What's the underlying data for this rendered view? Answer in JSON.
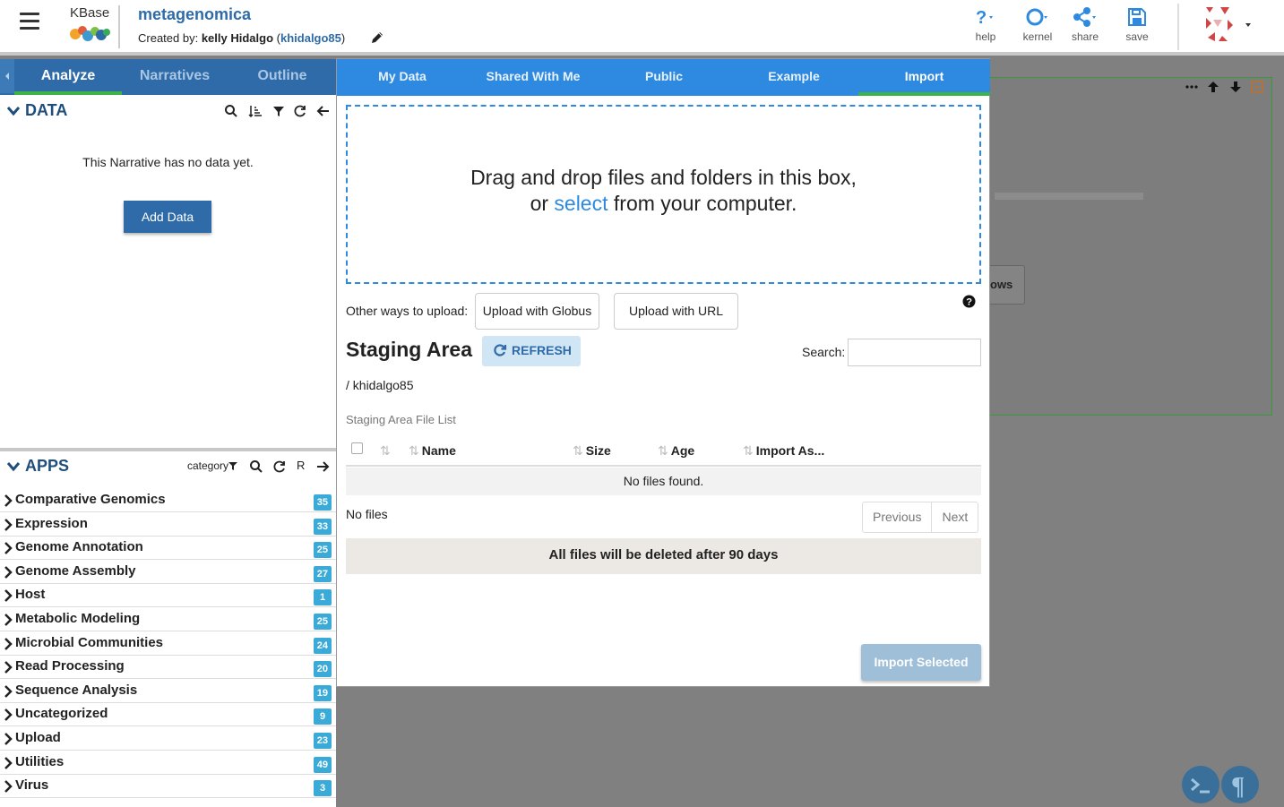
{
  "header": {
    "logo_text": "KBase",
    "narrative_title": "metagenomica",
    "created_by_prefix": "Created by: ",
    "owner_name": "kelly Hidalgo",
    "owner_open": " (",
    "owner_username": "khidalgo85",
    "owner_close": ")",
    "buttons": {
      "help": "help",
      "kernel": "kernel",
      "share": "share",
      "save": "save"
    }
  },
  "left_panel": {
    "tabs": [
      "Analyze",
      "Narratives",
      "Outline"
    ],
    "active_tab": "Analyze",
    "data_section": {
      "title": "DATA",
      "empty_message": "This Narrative has no data yet.",
      "add_button": "Add Data"
    },
    "apps_section": {
      "title": "APPS",
      "sort_label": "category",
      "r_label": "R",
      "categories": [
        {
          "name": "Comparative Genomics",
          "count": "35"
        },
        {
          "name": "Expression",
          "count": "33"
        },
        {
          "name": "Genome Annotation",
          "count": "25"
        },
        {
          "name": "Genome Assembly",
          "count": "27"
        },
        {
          "name": "Host",
          "count": "1"
        },
        {
          "name": "Metabolic Modeling",
          "count": "25"
        },
        {
          "name": "Microbial Communities",
          "count": "24"
        },
        {
          "name": "Read Processing",
          "count": "20"
        },
        {
          "name": "Sequence Analysis",
          "count": "19"
        },
        {
          "name": "Uncategorized",
          "count": "9"
        },
        {
          "name": "Upload",
          "count": "23"
        },
        {
          "name": "Utilities",
          "count": "49"
        },
        {
          "name": "Virus",
          "count": "3"
        }
      ]
    }
  },
  "background": {
    "partial_button_text": "ows"
  },
  "data_browser": {
    "tabs": [
      "My Data",
      "Shared With Me",
      "Public",
      "Example",
      "Import"
    ],
    "active_tab": "Import",
    "dropzone": {
      "line1": "Drag and drop files and folders in this box,",
      "line2_before": "or ",
      "line2_link": "select",
      "line2_after": " from your computer."
    },
    "other_ways_label": "Other ways to upload:",
    "upload_globus": "Upload with Globus",
    "upload_url": "Upload with URL",
    "staging": {
      "title": "Staging Area",
      "refresh": "REFRESH",
      "search_label": "Search:",
      "search_value": "",
      "path": "/ khidalgo85",
      "caption": "Staging Area File List",
      "columns": [
        "Name",
        "Size",
        "Age",
        "Import As..."
      ],
      "empty_row": "No files found.",
      "count_text": "No files",
      "prev": "Previous",
      "next": "Next",
      "warning": "All files will be deleted after 90 days",
      "import_selected": "Import Selected"
    }
  },
  "colors": {
    "brand_blue": "#2e6ba8",
    "tab_blue": "#2e8ae0",
    "active_green": "#3eb34a",
    "badge": "#3aaad8"
  }
}
